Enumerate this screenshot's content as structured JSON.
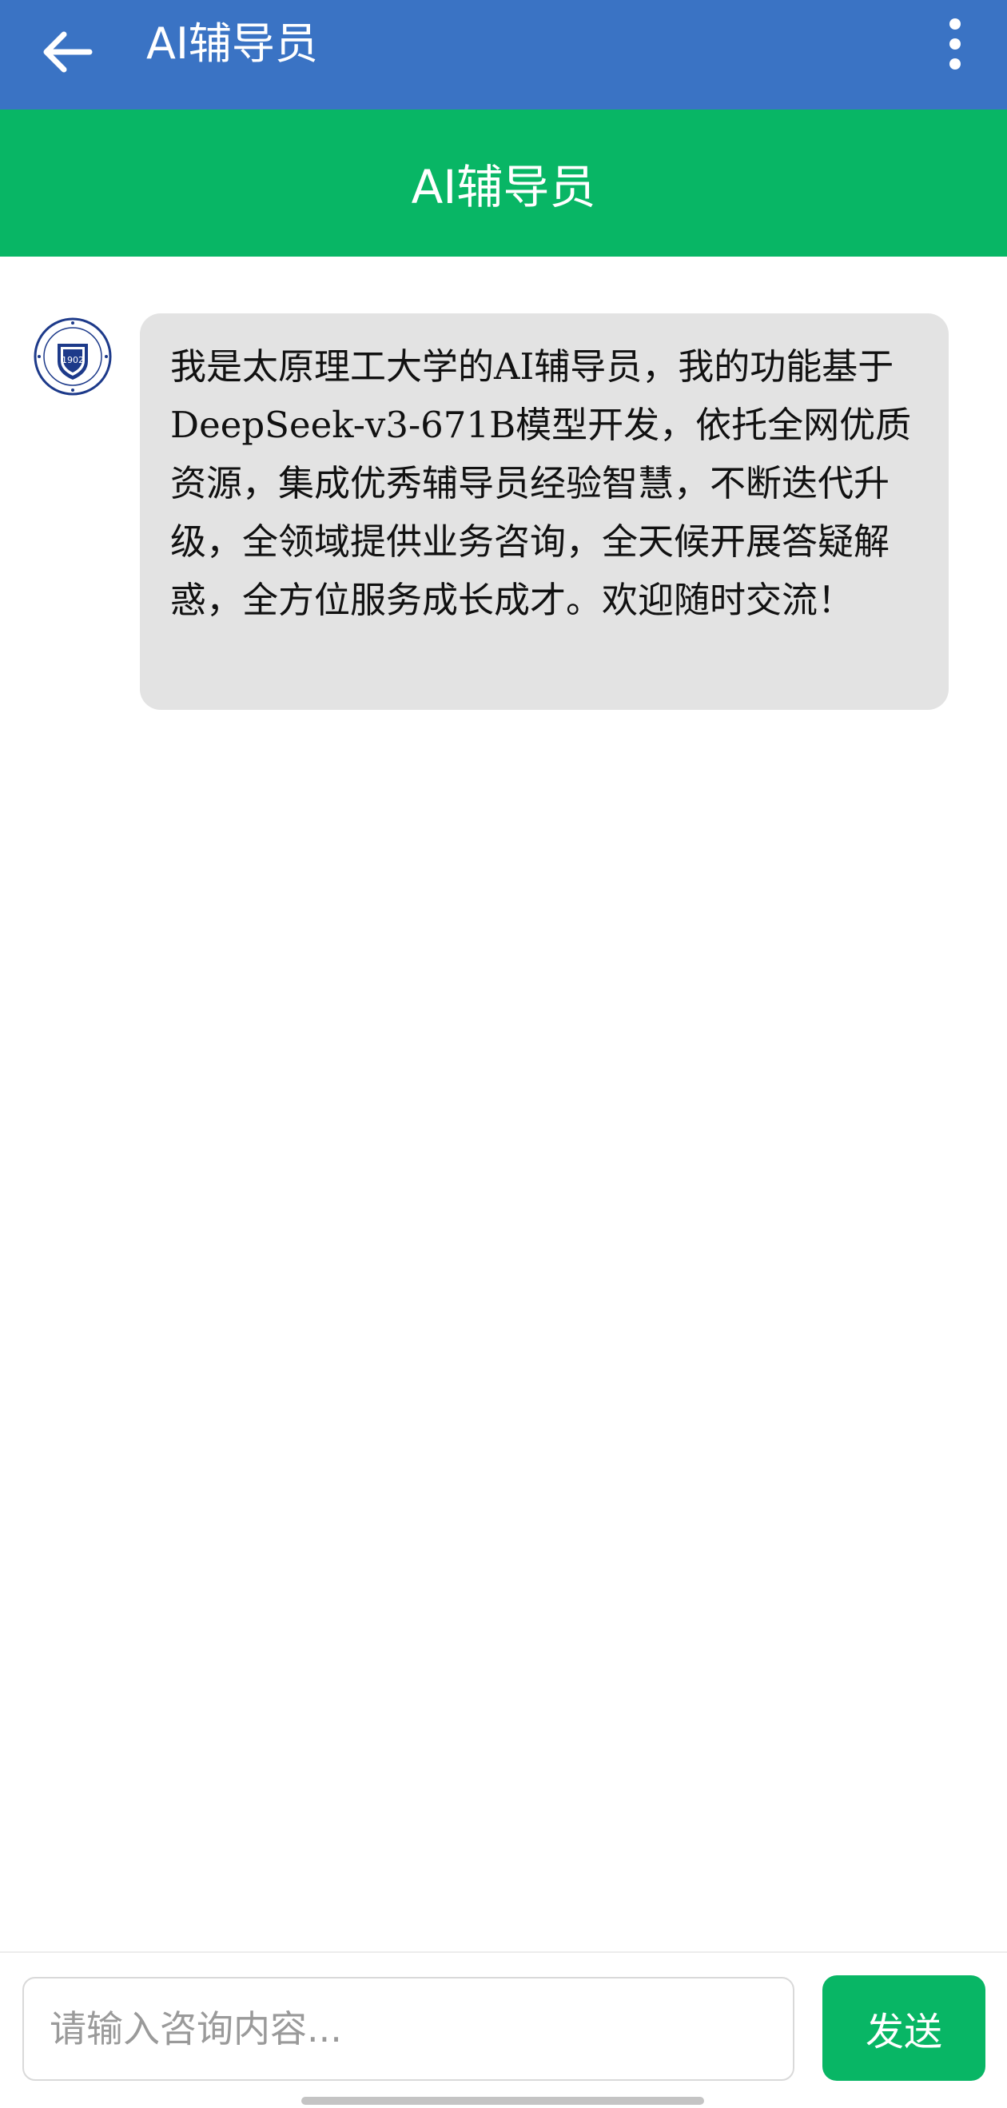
{
  "topbar": {
    "title": "AI辅导员",
    "back_icon": "arrow-left-icon",
    "more_icon": "more-vertical-icon",
    "bg_color": "#3a73c4"
  },
  "header": {
    "title": "AI辅导员",
    "bg_color": "#08b665"
  },
  "chat": {
    "messages": [
      {
        "sender_avatar": "university-logo-icon",
        "logo_year": "1902",
        "text": "我是太原理工大学的AI辅导员，我的功能基于DeepSeek-v3-671B模型开发，依托全网优质资源，集成优秀辅导员经验智慧，不断迭代升级，全领域提供业务咨询，全天候开展答疑解惑，全方位服务成长成才。欢迎随时交流！"
      }
    ]
  },
  "input": {
    "placeholder": "请输入咨询内容...",
    "value": "",
    "send_label": "发送"
  }
}
